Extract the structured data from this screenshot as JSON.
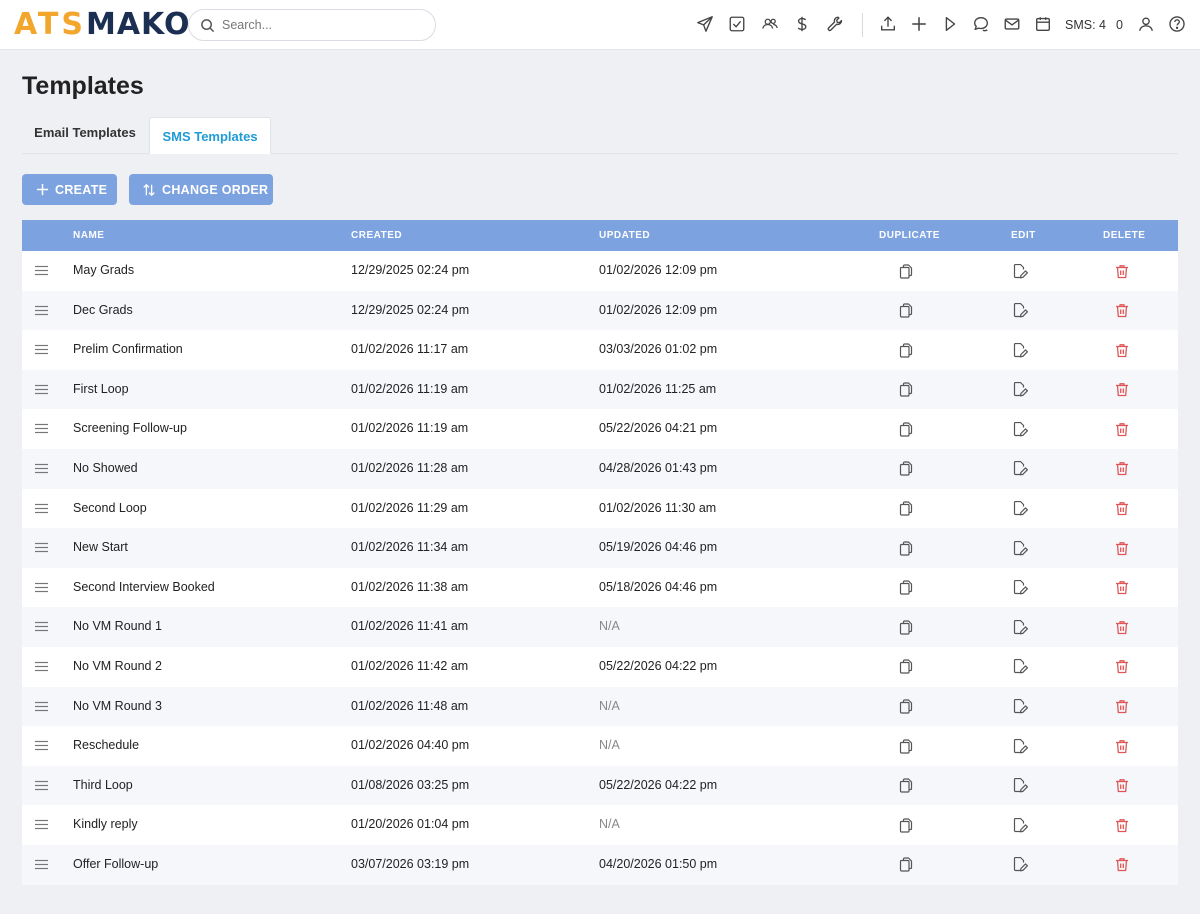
{
  "app": {
    "logo_left": "ATS",
    "logo_right": "MAKO"
  },
  "search": {
    "placeholder": "Search..."
  },
  "topbar": {
    "icons": [
      "send-icon",
      "checkbox-icon",
      "users-icon",
      "dollar-icon",
      "wrench-icon",
      "upload-icon",
      "plus-icon",
      "play-icon",
      "chat-icon",
      "mail-icon",
      "calendar-icon",
      "user-icon",
      "help-icon"
    ],
    "sms_label": "SMS: 4",
    "count": "0"
  },
  "page": {
    "title": "Templates"
  },
  "tabs": [
    {
      "label": "Email Templates",
      "active": false
    },
    {
      "label": "SMS Templates",
      "active": true
    }
  ],
  "actions": {
    "create_label": "CREATE",
    "order_label": "CHANGE ORDER"
  },
  "colors": {
    "accent": "#7da2e0",
    "active_tab": "#1f9bd6",
    "delete": "#e05555"
  },
  "table": {
    "headers": {
      "name": "NAME",
      "created": "CREATED",
      "updated": "UPDATED",
      "duplicate": "DUPLICATE",
      "edit": "EDIT",
      "delete": "DELETE"
    },
    "rows": [
      {
        "name": "May Grads",
        "created": "12/29/2025 02:24 pm",
        "updated": "01/02/2026 12:09 pm"
      },
      {
        "name": "Dec Grads",
        "created": "12/29/2025 02:24 pm",
        "updated": "01/02/2026 12:09 pm"
      },
      {
        "name": "Prelim Confirmation",
        "created": "01/02/2026 11:17 am",
        "updated": "03/03/2026 01:02 pm"
      },
      {
        "name": "First Loop",
        "created": "01/02/2026 11:19 am",
        "updated": "01/02/2026 11:25 am"
      },
      {
        "name": "Screening Follow-up",
        "created": "01/02/2026 11:19 am",
        "updated": "05/22/2026 04:21 pm"
      },
      {
        "name": "No Showed",
        "created": "01/02/2026 11:28 am",
        "updated": "04/28/2026 01:43 pm"
      },
      {
        "name": "Second Loop",
        "created": "01/02/2026 11:29 am",
        "updated": "01/02/2026 11:30 am"
      },
      {
        "name": "New Start",
        "created": "01/02/2026 11:34 am",
        "updated": "05/19/2026 04:46 pm"
      },
      {
        "name": "Second Interview Booked",
        "created": "01/02/2026 11:38 am",
        "updated": "05/18/2026 04:46 pm"
      },
      {
        "name": "No VM Round 1",
        "created": "01/02/2026 11:41 am",
        "updated": "N/A"
      },
      {
        "name": "No VM Round 2",
        "created": "01/02/2026 11:42 am",
        "updated": "05/22/2026 04:22 pm"
      },
      {
        "name": "No VM Round 3",
        "created": "01/02/2026 11:48 am",
        "updated": "N/A"
      },
      {
        "name": "Reschedule",
        "created": "01/02/2026 04:40 pm",
        "updated": "N/A"
      },
      {
        "name": "Third Loop",
        "created": "01/08/2026 03:25 pm",
        "updated": "05/22/2026 04:22 pm"
      },
      {
        "name": "Kindly reply",
        "created": "01/20/2026 01:04 pm",
        "updated": "N/A"
      },
      {
        "name": "Offer Follow-up",
        "created": "03/07/2026 03:19 pm",
        "updated": "04/20/2026 01:50 pm"
      }
    ]
  }
}
